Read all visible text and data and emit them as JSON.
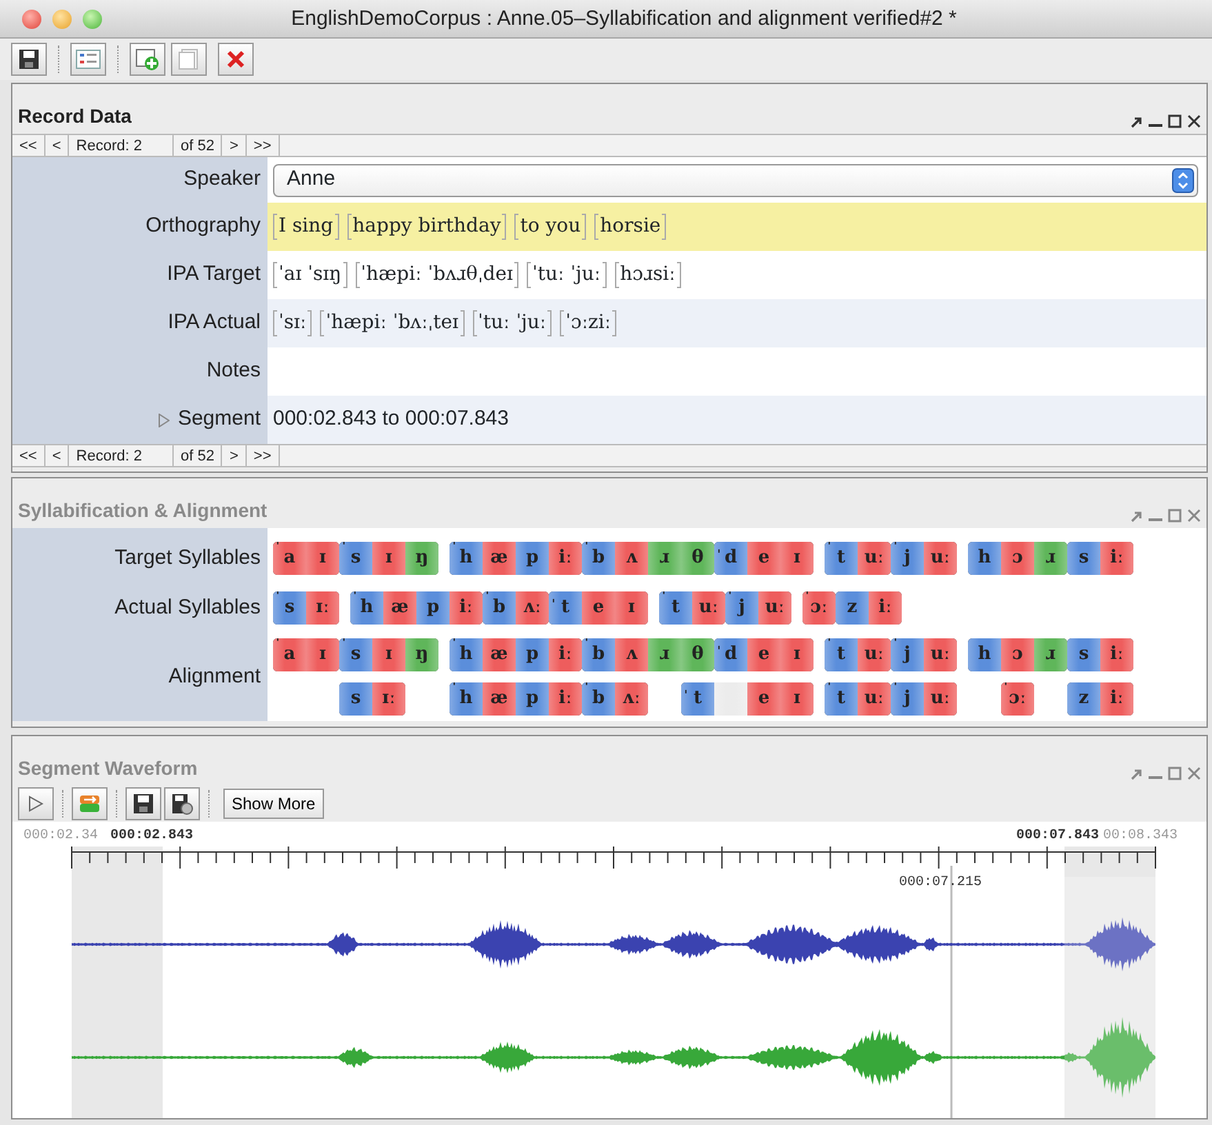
{
  "window": {
    "title": "EnglishDemoCorpus : Anne.05–Syllabification and alignment verified#2 *"
  },
  "record_data": {
    "title": "Record Data",
    "focused": true,
    "nav_top": {
      "first": "<<",
      "prev": "<",
      "record": "Record: 2",
      "count": "of 52",
      "next": ">",
      "last": ">>"
    },
    "fields": [
      {
        "kind": "dropdown",
        "label": "Speaker",
        "value": "Anne",
        "highlighted": false
      },
      {
        "kind": "groups",
        "label": "Orthography",
        "highlighted": true,
        "groups": [
          "I sing",
          "happy birthday",
          "to you",
          "horsie"
        ]
      },
      {
        "kind": "groups",
        "label": "IPA Target",
        "highlighted": false,
        "groups": [
          "ˈaɪ ˈsɪŋ",
          "ˈhæpiː ˈbʌɹθˌdeɪ",
          "ˈtuː ˈjuː",
          "hɔɹsiː"
        ]
      },
      {
        "kind": "groups",
        "label": "IPA Actual",
        "highlighted": false,
        "groups": [
          "ˈsɪː",
          "ˈhæpiː ˈbʌːˌteɪ",
          "ˈtuː ˈjuː",
          "ˈɔːziː"
        ]
      },
      {
        "kind": "text",
        "label": "Notes",
        "highlighted": false
      },
      {
        "kind": "segment",
        "label": "Segment",
        "value": "000:02.843 to 000:07.843",
        "expanded": false,
        "highlighted": false
      }
    ],
    "nav_bottom": {
      "first": "<<",
      "prev": "<",
      "record": "Record: 2",
      "count": "of 52",
      "next": ">",
      "last": ">>"
    }
  },
  "syllabification": {
    "title": "Syllabification & Alignment",
    "focused": false,
    "rows": [
      {
        "label": "Target Syllables",
        "words": [
          {
            "syllables": [
              [
                {
                  "text": "a",
                  "stress": "ˈ",
                  "color": "#ee5d5d"
                },
                {
                  "text": "ɪ",
                  "color": "#ee5d5d"
                }
              ],
              [
                {
                  "text": "s",
                  "stress": "ˈ",
                  "color": "#5b8edb"
                },
                {
                  "text": "ɪ",
                  "color": "#ee5d5d"
                },
                {
                  "text": "ŋ",
                  "color": "#5fb65a"
                }
              ]
            ]
          },
          {
            "syllables": [
              [
                {
                  "text": "h",
                  "stress": "ˈ",
                  "color": "#5b8edb"
                },
                {
                  "text": "æ",
                  "color": "#ee5d5d"
                },
                {
                  "text": "p",
                  "color": "#5b8edb"
                },
                {
                  "text": "iː",
                  "color": "#ee5d5d"
                }
              ],
              [
                {
                  "text": "b",
                  "stress": "ˈ",
                  "color": "#5b8edb"
                },
                {
                  "text": "ʌ",
                  "color": "#ee5d5d"
                },
                {
                  "text": "ɹ",
                  "color": "#5fb65a"
                },
                {
                  "text": "θ",
                  "color": "#5fb65a"
                }
              ],
              [
                {
                  "text": "d",
                  "stress": "ˌ",
                  "color": "#5b8edb"
                },
                {
                  "text": "e",
                  "color": "#ee5d5d"
                },
                {
                  "text": "ɪ",
                  "color": "#ee5d5d"
                }
              ]
            ]
          },
          {
            "syllables": [
              [
                {
                  "text": "t",
                  "stress": "ˈ",
                  "color": "#5b8edb"
                },
                {
                  "text": "uː",
                  "color": "#ee5d5d"
                }
              ],
              [
                {
                  "text": "j",
                  "stress": "ˈ",
                  "color": "#5b8edb"
                },
                {
                  "text": "uː",
                  "color": "#ee5d5d"
                }
              ]
            ]
          },
          {
            "syllables": [
              [
                {
                  "text": "h",
                  "color": "#5b8edb"
                },
                {
                  "text": "ɔ",
                  "color": "#ee5d5d"
                },
                {
                  "text": "ɹ",
                  "color": "#5fb65a"
                }
              ],
              [
                {
                  "text": "s",
                  "color": "#5b8edb"
                },
                {
                  "text": "iː",
                  "color": "#ee5d5d"
                }
              ]
            ]
          }
        ]
      },
      {
        "label": "Actual Syllables",
        "words": [
          {
            "syllables": [
              [
                {
                  "text": "s",
                  "stress": "ˈ",
                  "color": "#5b8edb"
                },
                {
                  "text": "ɪː",
                  "color": "#ee5d5d"
                }
              ]
            ]
          },
          {
            "syllables": [
              [
                {
                  "text": "h",
                  "stress": "ˈ",
                  "color": "#5b8edb"
                },
                {
                  "text": "æ",
                  "color": "#ee5d5d"
                },
                {
                  "text": "p",
                  "color": "#5b8edb"
                },
                {
                  "text": "iː",
                  "color": "#ee5d5d"
                }
              ],
              [
                {
                  "text": "b",
                  "stress": "ˈ",
                  "color": "#5b8edb"
                },
                {
                  "text": "ʌː",
                  "color": "#ee5d5d"
                }
              ],
              [
                {
                  "text": "t",
                  "stress": "ˌ",
                  "color": "#5b8edb"
                },
                {
                  "text": "e",
                  "color": "#ee5d5d"
                },
                {
                  "text": "ɪ",
                  "color": "#ee5d5d"
                }
              ]
            ]
          },
          {
            "syllables": [
              [
                {
                  "text": "t",
                  "stress": "ˈ",
                  "color": "#5b8edb"
                },
                {
                  "text": "uː",
                  "color": "#ee5d5d"
                }
              ],
              [
                {
                  "text": "j",
                  "stress": "ˈ",
                  "color": "#5b8edb"
                },
                {
                  "text": "uː",
                  "color": "#ee5d5d"
                }
              ]
            ]
          },
          {
            "syllables": [
              [
                {
                  "text": "ɔː",
                  "stress": "ˈ",
                  "color": "#ee5d5d"
                }
              ],
              [
                {
                  "text": "z",
                  "color": "#5b8edb"
                },
                {
                  "text": "iː",
                  "color": "#ee5d5d"
                }
              ]
            ]
          }
        ]
      }
    ],
    "alignment": {
      "label": "Alignment",
      "target": [
        {
          "items": [
            {
              "kind": "syllable",
              "phones": [
                {
                  "text": "a",
                  "stress": "ˈ",
                  "color": "#ee5d5d"
                },
                {
                  "text": "ɪ",
                  "color": "#ee5d5d"
                }
              ]
            },
            {
              "kind": "syllable",
              "phones": [
                {
                  "text": "s",
                  "stress": "ˈ",
                  "color": "#5b8edb"
                },
                {
                  "text": "ɪ",
                  "color": "#ee5d5d"
                },
                {
                  "text": "ŋ",
                  "color": "#5fb65a"
                }
              ]
            }
          ]
        },
        {
          "items": [
            {
              "kind": "syllable",
              "phones": [
                {
                  "text": "h",
                  "stress": "ˈ",
                  "color": "#5b8edb"
                },
                {
                  "text": "æ",
                  "color": "#ee5d5d"
                },
                {
                  "text": "p",
                  "color": "#5b8edb"
                },
                {
                  "text": "iː",
                  "color": "#ee5d5d"
                }
              ]
            },
            {
              "kind": "syllable",
              "phones": [
                {
                  "text": "b",
                  "stress": "ˈ",
                  "color": "#5b8edb"
                },
                {
                  "text": "ʌ",
                  "color": "#ee5d5d"
                },
                {
                  "text": "ɹ",
                  "color": "#5fb65a"
                },
                {
                  "text": "θ",
                  "color": "#5fb65a"
                }
              ]
            },
            {
              "kind": "syllable",
              "phones": [
                {
                  "text": "d",
                  "stress": "ˌ",
                  "color": "#5b8edb"
                },
                {
                  "text": "e",
                  "color": "#ee5d5d"
                },
                {
                  "text": "ɪ",
                  "color": "#ee5d5d"
                }
              ]
            }
          ]
        },
        {
          "items": [
            {
              "kind": "syllable",
              "phones": [
                {
                  "text": "t",
                  "stress": "ˈ",
                  "color": "#5b8edb"
                },
                {
                  "text": "uː",
                  "color": "#ee5d5d"
                }
              ]
            },
            {
              "kind": "syllable",
              "phones": [
                {
                  "text": "j",
                  "stress": "ˈ",
                  "color": "#5b8edb"
                },
                {
                  "text": "uː",
                  "color": "#ee5d5d"
                }
              ]
            }
          ]
        },
        {
          "items": [
            {
              "kind": "syllable",
              "phones": [
                {
                  "text": "h",
                  "color": "#5b8edb"
                },
                {
                  "text": "ɔ",
                  "color": "#ee5d5d"
                },
                {
                  "text": "ɹ",
                  "color": "#5fb65a"
                }
              ]
            },
            {
              "kind": "syllable",
              "phones": [
                {
                  "text": "s",
                  "color": "#5b8edb"
                },
                {
                  "text": "iː",
                  "color": "#ee5d5d"
                }
              ]
            }
          ]
        }
      ],
      "actual": [
        {
          "items": [
            {
              "kind": "spacer"
            },
            {
              "kind": "spacer"
            },
            {
              "kind": "syllable",
              "phones": [
                {
                  "text": "s",
                  "color": "#5b8edb"
                },
                {
                  "text": "ɪː",
                  "color": "#ee5d5d"
                }
              ]
            },
            {
              "kind": "spacer"
            }
          ]
        },
        {
          "items": [
            {
              "kind": "syllable",
              "phones": [
                {
                  "text": "h",
                  "stress": "ˈ",
                  "color": "#5b8edb"
                },
                {
                  "text": "æ",
                  "color": "#ee5d5d"
                },
                {
                  "text": "p",
                  "color": "#5b8edb"
                },
                {
                  "text": "iː",
                  "color": "#ee5d5d"
                }
              ]
            },
            {
              "kind": "syllable",
              "phones": [
                {
                  "text": "b",
                  "stress": "ˈ",
                  "color": "#5b8edb"
                },
                {
                  "text": "ʌː",
                  "color": "#ee5d5d"
                }
              ]
            },
            {
              "kind": "spacer"
            },
            {
              "kind": "syllable",
              "phones": [
                {
                  "text": "t",
                  "stress": "ˌ",
                  "color": "#5b8edb"
                },
                {
                  "color": "#ececec"
                },
                {
                  "text": "e",
                  "color": "#ee5d5d"
                },
                {
                  "text": "ɪ",
                  "color": "#ee5d5d"
                }
              ]
            }
          ]
        },
        {
          "items": [
            {
              "kind": "syllable",
              "phones": [
                {
                  "text": "t",
                  "stress": "ˈ",
                  "color": "#5b8edb"
                },
                {
                  "text": "uː",
                  "color": "#ee5d5d"
                }
              ]
            },
            {
              "kind": "syllable",
              "phones": [
                {
                  "text": "j",
                  "stress": "ˈ",
                  "color": "#5b8edb"
                },
                {
                  "text": "uː",
                  "color": "#ee5d5d"
                }
              ]
            }
          ]
        },
        {
          "items": [
            {
              "kind": "spacer"
            },
            {
              "kind": "syllable",
              "phones": [
                {
                  "text": "ɔː",
                  "stress": "ˈ",
                  "color": "#ee5d5d"
                }
              ]
            },
            {
              "kind": "spacer"
            },
            {
              "kind": "syllable",
              "phones": [
                {
                  "text": "z",
                  "color": "#5b8edb"
                },
                {
                  "text": "iː",
                  "color": "#ee5d5d"
                }
              ]
            }
          ]
        }
      ]
    }
  },
  "waveform": {
    "title": "Segment Waveform",
    "focused": false,
    "show_more": "Show More",
    "ruler": {
      "before_start": "000:02.34",
      "start": "000:02.843",
      "end": "000:07.843",
      "after_end": "00:08.343",
      "cursor": "000:07.215"
    }
  }
}
